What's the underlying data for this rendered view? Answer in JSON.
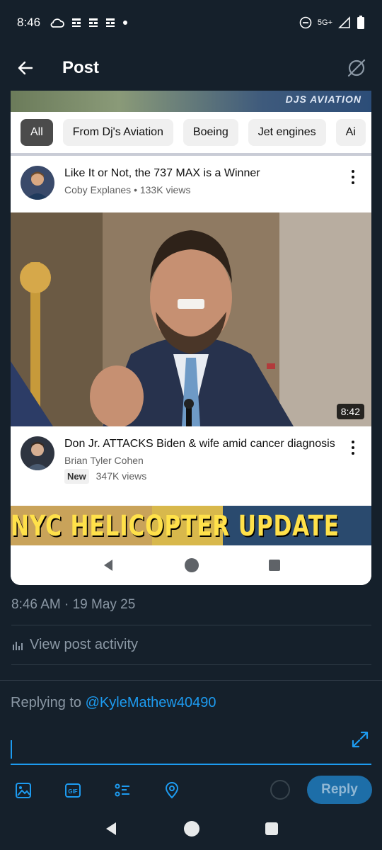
{
  "status_bar": {
    "time": "8:46",
    "network": "5G+",
    "icons": [
      "cloud-icon",
      "notification-icon",
      "notification-icon",
      "notification-icon",
      "dot-icon",
      "dnd-icon",
      "signal-icon",
      "battery-icon"
    ]
  },
  "header": {
    "title": "Post",
    "back_icon": "arrow-left-icon",
    "grok_icon": "grok-icon"
  },
  "embed": {
    "banner_brand": "DJS AVIATION",
    "chips": [
      "All",
      "From Dj's Aviation",
      "Boeing",
      "Jet engines",
      "Ai"
    ],
    "videos": [
      {
        "title": "Like It or Not, the 737 MAX is a Winner",
        "channel": "Coby Explanes",
        "separator": "•",
        "views": "133K views"
      },
      {
        "title": "Don Jr. ATTACKS Biden & wife amid cancer diagnosis",
        "channel": "Brian Tyler Cohen",
        "badge": "New",
        "views": "347K views",
        "duration": "8:42"
      }
    ],
    "next_thumbnail_headline": "NYC HELICOPTER UPDATE"
  },
  "post": {
    "timestamp": "8:46 AM · 19 May 25",
    "activity": "View post activity"
  },
  "reply": {
    "replying_prefix": "Replying to",
    "handle": "@KyleMathew40490",
    "button": "Reply",
    "accent": "#1d9bf0"
  }
}
